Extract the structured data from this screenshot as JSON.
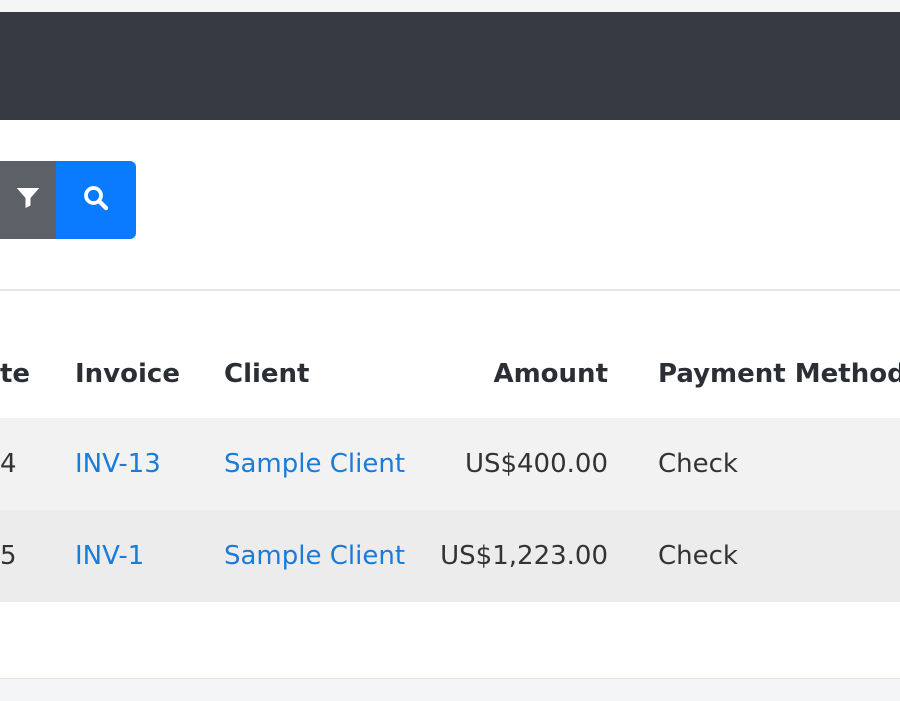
{
  "toolbar": {
    "filter_icon": "filter-icon",
    "search_icon": "search-icon"
  },
  "colors": {
    "header": "#363a42",
    "filter_button": "#5c6168",
    "search_button": "#0a7bff",
    "link": "#1a7bd8",
    "row_stripe": "#f2f2f2"
  },
  "table": {
    "columns": [
      "te",
      "Invoice",
      "Client",
      "Amount",
      "Payment Method"
    ],
    "rows": [
      {
        "date": "4",
        "invoice": "INV-13",
        "client": "Sample Client",
        "amount": "US$400.00",
        "method": "Check"
      },
      {
        "date": "5",
        "invoice": "INV-1",
        "client": "Sample Client",
        "amount": "US$1,223.00",
        "method": "Check"
      }
    ]
  }
}
